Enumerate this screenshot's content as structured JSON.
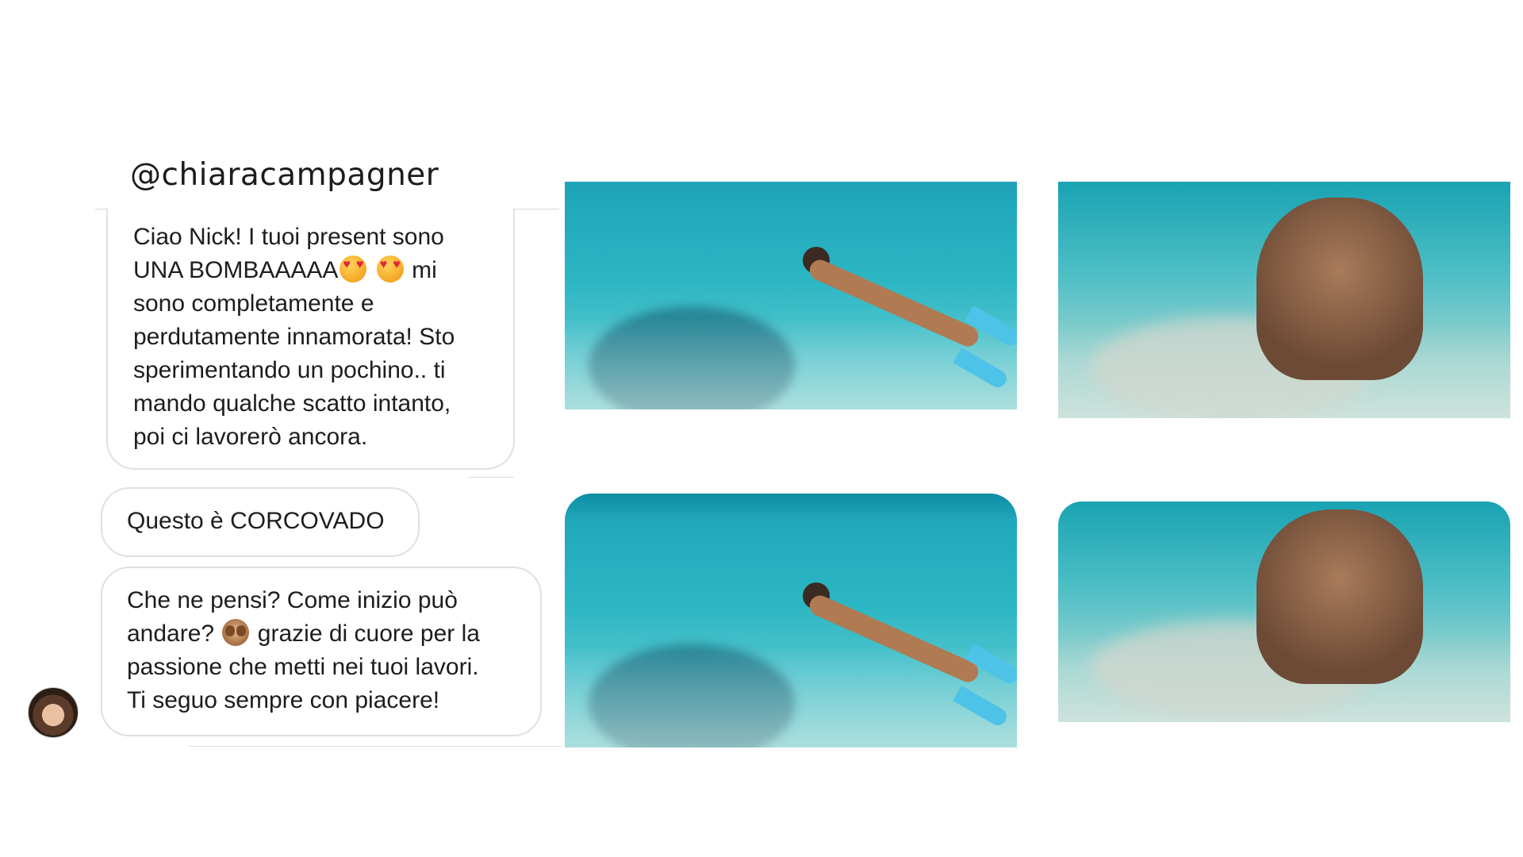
{
  "profile": {
    "handle": "@chiaracampagner",
    "avatar_alt": "profile photo"
  },
  "messages": [
    {
      "lines": [
        "Ciao Nick! I tuoi present sono",
        "UNA BOMBAAAAA",
        "mi",
        "sono completamente e",
        "perdutamente innamorata! Sto",
        "sperimentando un pochino.. ti",
        "mando qualche scatto intanto,",
        "poi ci lavorerò ancora."
      ],
      "emojis": [
        "heart-eyes-emoji",
        "heart-eyes-emoji"
      ]
    },
    {
      "text": "Questo è CORCOVADO"
    },
    {
      "lines": [
        "Che ne pensi? Come inizio può",
        "andare?",
        "grazie di cuore per la",
        "passione che metti nei tuoi lavori.",
        "Ti seguo sempre con piacere!"
      ],
      "emojis": [
        "see-no-evil-monkey-emoji"
      ]
    }
  ],
  "photos": [
    {
      "subject": "snorkeler underwater, before"
    },
    {
      "subject": "couple underwater, before"
    },
    {
      "subject": "snorkeler underwater, after"
    },
    {
      "subject": "couple underwater, after"
    }
  ],
  "colors": {
    "water": "#2db7c4",
    "bubble_border": "#e0e0e0",
    "text": "#1d1d1d"
  }
}
